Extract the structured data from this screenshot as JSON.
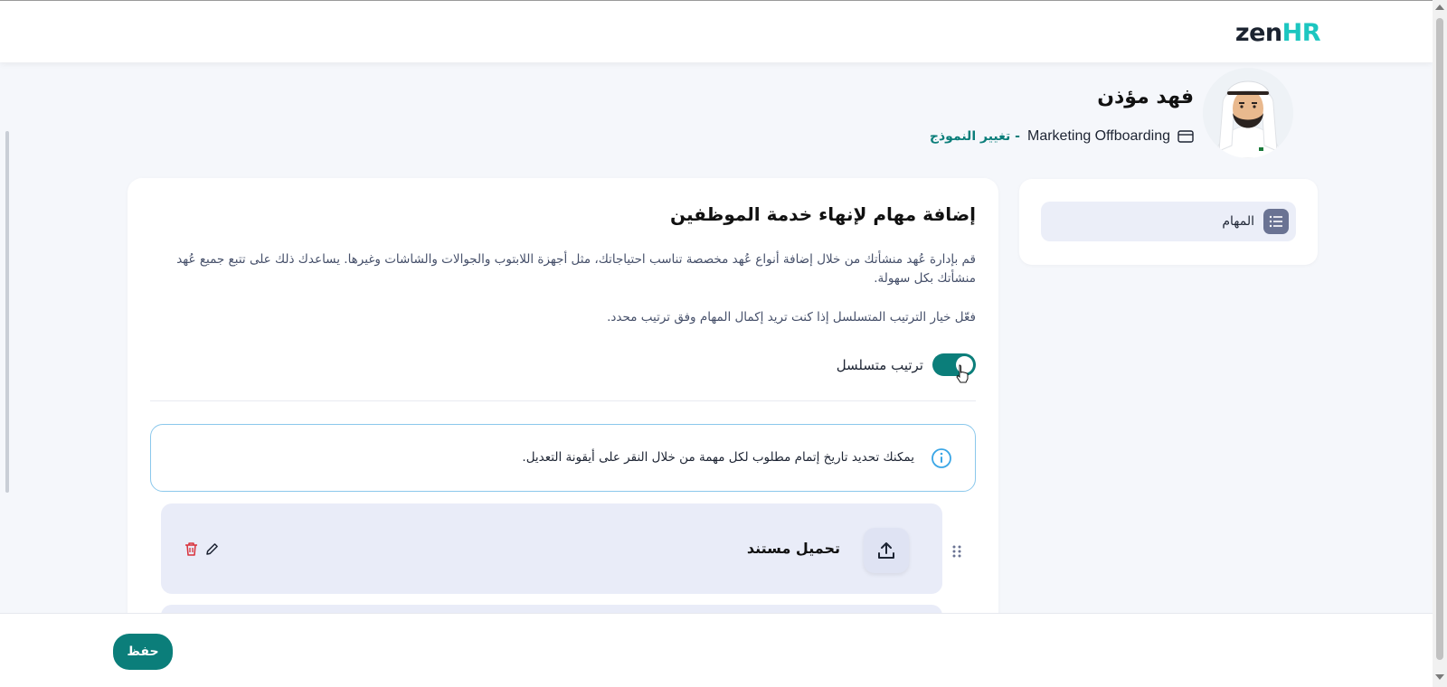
{
  "brand": {
    "logo_part1": "zen",
    "logo_part2": "HR"
  },
  "employee": {
    "name": "فهد مؤذن",
    "template_name": "Marketing Offboarding",
    "change_template_link": "- تغيير النموذج"
  },
  "sidebar": {
    "items": [
      {
        "label": "المهام",
        "icon": "list-icon"
      }
    ]
  },
  "main": {
    "title": "إضافة مهام لإنهاء خدمة الموظفين",
    "description": "قم بإدارة عُهد منشأتك من خلال إضافة أنواع عُهد مخصصة تناسب احتياجاتك، مثل أجهزة اللابتوب والجوالات والشاشات وغيرها. يساعدك ذلك على تتبع جميع عُهد منشأتك بكل سهولة.",
    "hint": "فعّل خيار الترتيب المتسلسل إذا كنت تريد إكمال المهام وفق ترتيب محدد.",
    "toggle_label": "ترتيب متسلسل",
    "toggle_on": true,
    "info_text": "يمكنك تحديد تاريخ إتمام مطلوب لكل مهمة من خلال النقر على أيقونة التعديل.",
    "tasks": [
      {
        "title": "تحميل مستند",
        "icon": "upload-icon"
      }
    ]
  },
  "footer": {
    "save_label": "حفظ"
  },
  "colors": {
    "accent": "#0b7e7a",
    "brand_hr": "#1cc6c0",
    "info_border": "#8bc8ec",
    "delete": "#d9303a"
  }
}
